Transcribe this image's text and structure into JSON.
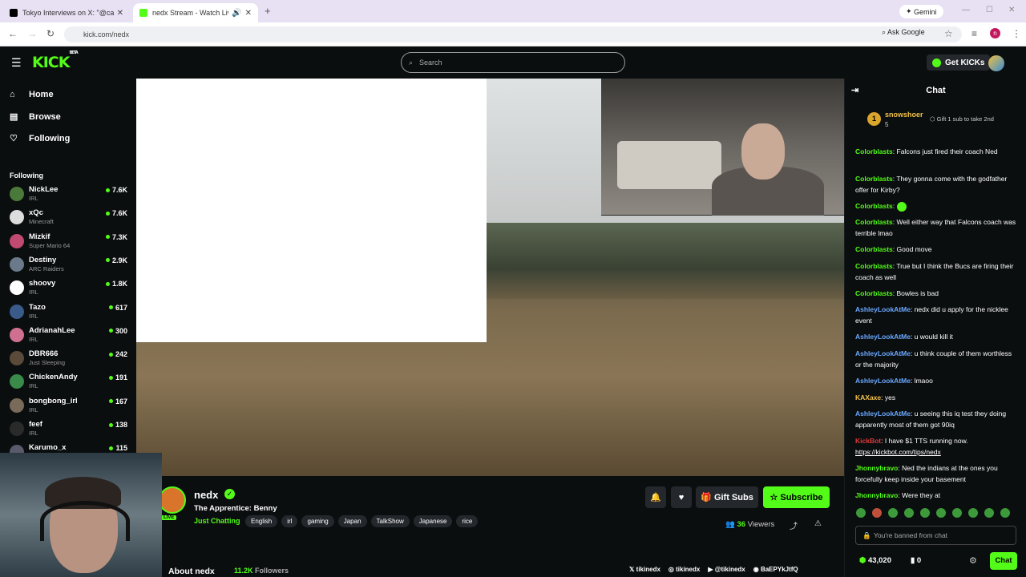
{
  "browser": {
    "tabs": [
      {
        "title": "Tokyo Interviews on X: \"@calli",
        "favicon_color": "#000000"
      },
      {
        "title": "nedx Stream - Watch Live o",
        "favicon_color": "#53fc18"
      }
    ],
    "new_tab": "+",
    "gemini": "Gemini",
    "url": "kick.com/nedx",
    "ask_google": "Ask Google"
  },
  "header": {
    "logo": "KICK",
    "beta": "BETA",
    "search_placeholder": "Search",
    "get_kicks": "Get KICKs"
  },
  "sidebar": {
    "nav": [
      {
        "icon": "home-icon",
        "label": "Home"
      },
      {
        "icon": "browse-icon",
        "label": "Browse"
      },
      {
        "icon": "heart-icon",
        "label": "Following"
      }
    ],
    "following_heading": "Following",
    "following": [
      {
        "name": "NickLee",
        "category": "IRL",
        "viewers": "7.6K",
        "color": "#4a7a3a"
      },
      {
        "name": "xQc",
        "category": "Minecraft",
        "viewers": "7.6K",
        "color": "#dddddd"
      },
      {
        "name": "Mizkif",
        "category": "Super Mario 64",
        "viewers": "7.3K",
        "color": "#c04a70"
      },
      {
        "name": "Destiny",
        "category": "ARC Raiders",
        "viewers": "2.9K",
        "color": "#6a7a8a"
      },
      {
        "name": "shoovy",
        "category": "IRL",
        "viewers": "1.8K",
        "color": "#ffffff"
      },
      {
        "name": "Tazo",
        "category": "IRL",
        "viewers": "617",
        "color": "#3a5a8a"
      },
      {
        "name": "AdrianahLee",
        "category": "IRL",
        "viewers": "300",
        "color": "#d07090"
      },
      {
        "name": "DBR666",
        "category": "Just Sleeping",
        "viewers": "242",
        "color": "#5a4a3a"
      },
      {
        "name": "ChickenAndy",
        "category": "IRL",
        "viewers": "191",
        "color": "#3a8a4a"
      },
      {
        "name": "bongbong_irl",
        "category": "IRL",
        "viewers": "167",
        "color": "#7a6a5a"
      },
      {
        "name": "feef",
        "category": "IRL",
        "viewers": "138",
        "color": "#2a2a2a"
      },
      {
        "name": "Karumo_x",
        "category": "",
        "viewers": "115",
        "color": "#5a5a6a"
      }
    ]
  },
  "stream": {
    "name": "nedx",
    "live": "LIVE",
    "title": "The Apprentice: Benny",
    "category": "Just Chatting",
    "tags": [
      "English",
      "irl",
      "gaming",
      "Japan",
      "TalkShow",
      "Japanese",
      "rice"
    ],
    "gift_subs": "Gift Subs",
    "subscribe": "Subscribe",
    "viewers": "36",
    "viewers_label": "Viewers",
    "about": "About nedx",
    "followers": "11.2K",
    "followers_label": "Followers",
    "socials": [
      "tikinedx",
      "tikinedx",
      "@tikinedx",
      "BaEPYkJtfQ"
    ]
  },
  "chat": {
    "title": "Chat",
    "pinned": {
      "rank": "1",
      "user": "snowshoer",
      "subs": "5",
      "gift": "Gift 1 sub to take 2nd"
    },
    "messages": [
      {
        "user": "Colorblasts",
        "text": "Falcons just fired their coach Ned",
        "color": "#53fc18"
      },
      {
        "user": "Colorblasts",
        "text": "They gonna come with the godfather offer for Kirby?",
        "color": "#53fc18"
      },
      {
        "user": "Colorblasts",
        "text": "",
        "color": "#53fc18"
      },
      {
        "user": "Colorblasts",
        "text": "Well either way that Falcons coach was terrible lmao",
        "color": "#53fc18"
      },
      {
        "user": "Colorblasts",
        "text": "Good move",
        "color": "#53fc18"
      },
      {
        "user": "Colorblasts",
        "text": "True but I think the Bucs are firing their coach as well",
        "color": "#53fc18"
      },
      {
        "user": "Colorblasts",
        "text": "Bowles is bad",
        "color": "#53fc18"
      },
      {
        "user": "AshleyLookAtMe",
        "text": "nedx did u apply for the nicklee event",
        "color": "#6aa8ff"
      },
      {
        "user": "AshleyLookAtMe",
        "text": "u would kill it",
        "color": "#6aa8ff"
      },
      {
        "user": "AshleyLookAtMe",
        "text": "u think couple of them worthless or the majority",
        "color": "#6aa8ff"
      },
      {
        "user": "AshleyLookAtMe",
        "text": "lmaoo",
        "color": "#6aa8ff"
      },
      {
        "user": "KAXaxe",
        "text": "yes",
        "color": "#f2c14a"
      },
      {
        "user": "AshleyLookAtMe",
        "text": "u seeing this iq test they doing apparently most of them got 90iq",
        "color": "#6aa8ff"
      },
      {
        "user": "KickBot",
        "text": "I have $1 TTS running now.",
        "link": "https://kickbot.com/tips/nedx",
        "color": "#e03a3a"
      },
      {
        "user": "Jhonnybravo",
        "text": "Ned the indians at the ones you forcefully keep inside your basement",
        "color": "#53fc18"
      },
      {
        "user": "Jhonnybravo",
        "text": "Were they at",
        "color": "#53fc18"
      }
    ],
    "banned": "You're banned from chat",
    "points": "43,020",
    "points2": "0",
    "chat_button": "Chat"
  },
  "colors": {
    "accent": "#53fc18",
    "bg": "#0b0e0f"
  }
}
